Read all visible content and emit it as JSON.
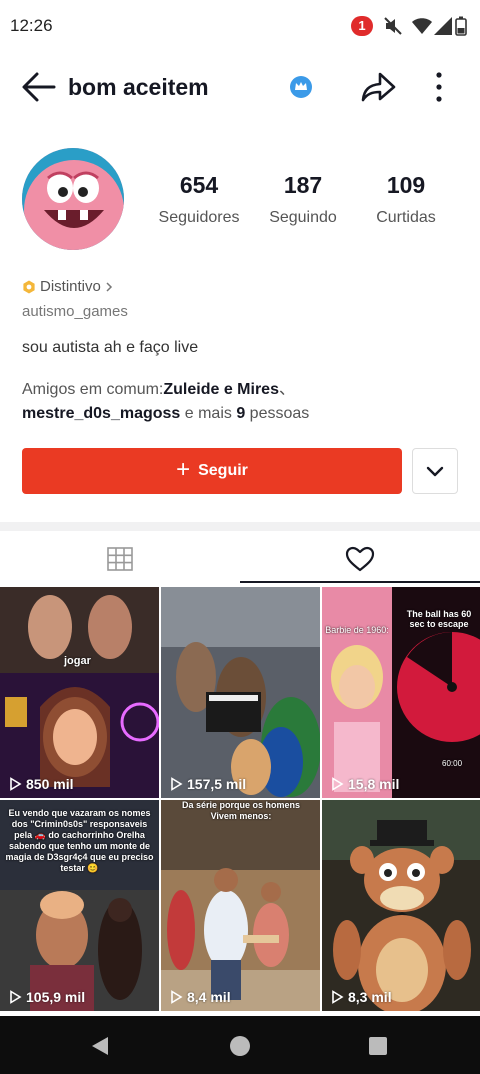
{
  "status": {
    "time": "12:26",
    "notifications": "1"
  },
  "header": {
    "name": "bom aceitem"
  },
  "stats": [
    {
      "value": "654",
      "label": "Seguidores"
    },
    {
      "value": "187",
      "label": "Seguindo"
    },
    {
      "value": "109",
      "label": "Curtidas"
    }
  ],
  "profile": {
    "badge_label": "Distintivo",
    "username": "autismo_games",
    "bio": "sou autista ah e faço live",
    "friends_prefix": "Amigos em comum:",
    "friend1": "Zuleide e Mires",
    "friend_sep": "、",
    "friend2": "mestre_d0s_magoss",
    "friends_mid": " e mais ",
    "friends_count": "9",
    "friends_suffix": " pessoas"
  },
  "actions": {
    "follow_label": "Seguir"
  },
  "videos": [
    {
      "views": "850 mil",
      "caption": "jogar"
    },
    {
      "views": "157,5 mil",
      "caption": ""
    },
    {
      "views": "15,8 mil",
      "caption": "The ball has 60 sec to escape",
      "caption2": "Barbie de 1960:",
      "caption3": "60:00"
    },
    {
      "views": "105,9 mil",
      "caption": "Eu vendo que vazaram os nomes dos \"Crimin0s0s\" responsaveis pela 🚗 do cachorrinho Orelha sabendo que tenho um monte de magia de D3sgr4ç4 que eu preciso testar 😊"
    },
    {
      "views": "8,4 mil",
      "caption": "Da série porque os homens Vivem menos:"
    },
    {
      "views": "8,3 mil",
      "caption": ""
    }
  ],
  "colors": {
    "accent": "#ea3a23",
    "text": "#161823",
    "crown": "#3b9ae8"
  }
}
